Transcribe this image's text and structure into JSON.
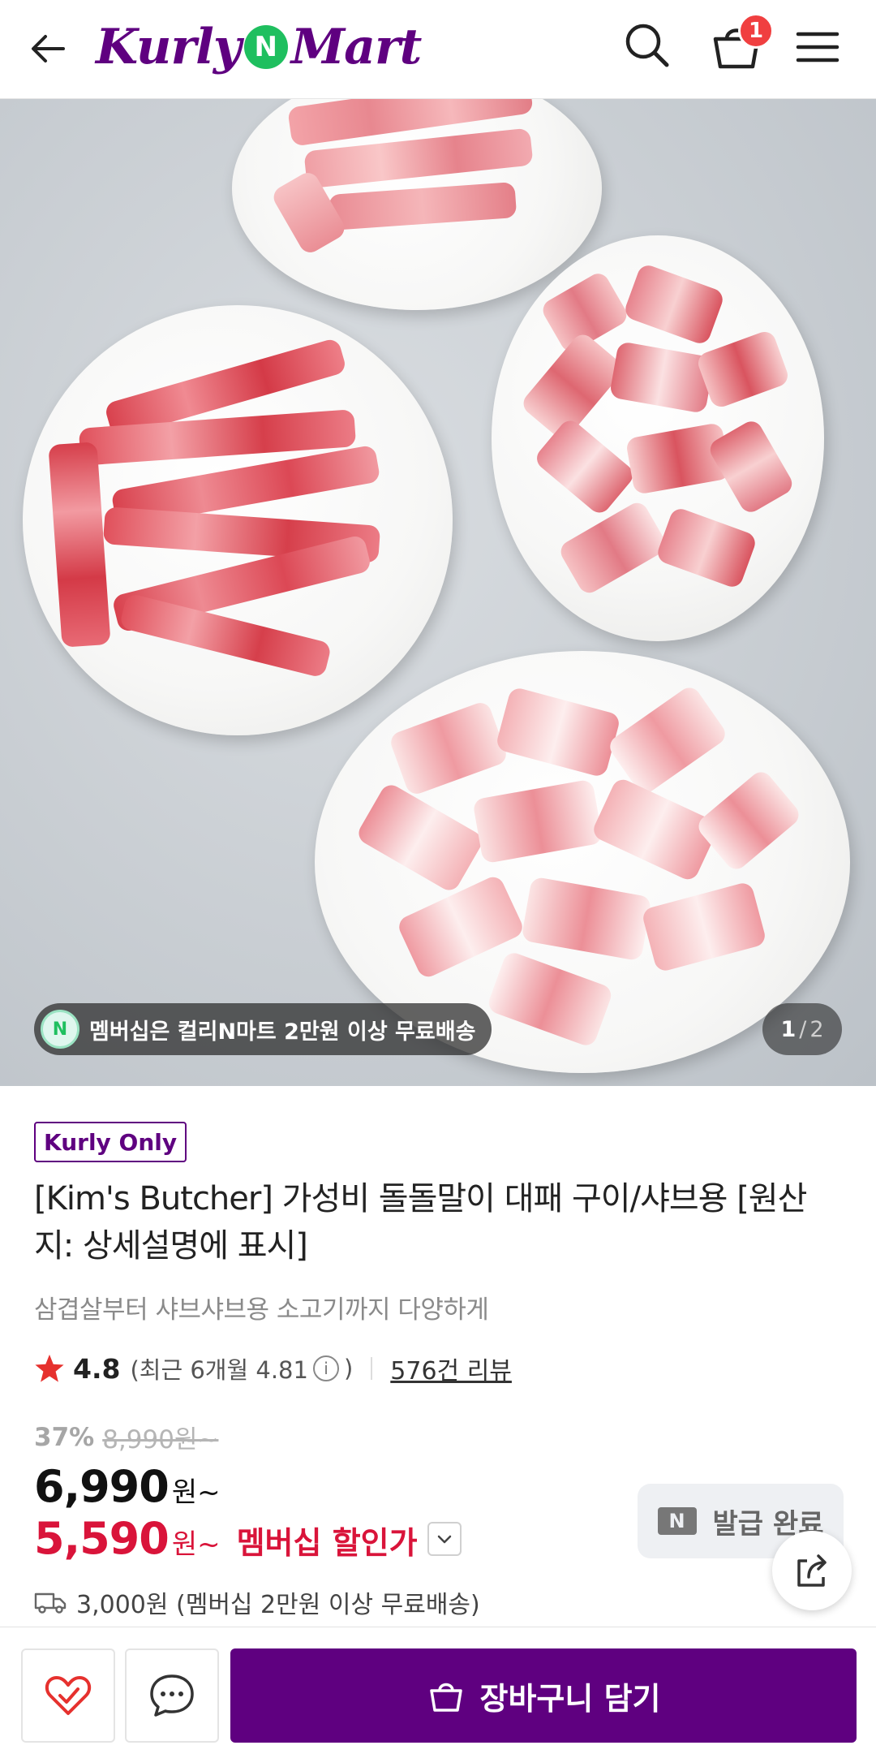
{
  "header": {
    "logo_part1": "Kurly",
    "logo_n": "N",
    "logo_part2": "Mart",
    "cart_count": "1"
  },
  "hero": {
    "membership_notice": "멤버십은 컬리N마트 2만원 이상 무료배송",
    "membership_n": "N",
    "page_current": "1",
    "page_separator": "/",
    "page_total": "2"
  },
  "product": {
    "badge": "Kurly Only",
    "title": "[Kim's Butcher] 가성비 돌돌말이 대패 구이/샤브용 [원산지: 상세설명에 표시]",
    "subtitle": "삼겹살부터 샤브샤브용 소고기까지 다양하게",
    "rating": "4.8",
    "recent_rating_text": "(최근 6개월 4.81",
    "recent_rating_close": ")",
    "review_count": "576건 리뷰",
    "discount_rate": "37%",
    "original_price": "8,990원~",
    "price": "6,990",
    "price_unit": "원~",
    "member_price": "5,590",
    "member_price_unit": "원~",
    "member_price_label": "멤버십 할인가",
    "coupon_mark": "N",
    "coupon_label": "발급 완료",
    "delivery": "3,000원 (멤버십 2만원 이상 무료배송)"
  },
  "bottom_bar": {
    "add_to_cart": "장바구니 담기"
  },
  "colors": {
    "brand_purple": "#5f0080",
    "member_red": "#d9143a",
    "badge_red": "#f03f40",
    "n_green": "#1fbf5f"
  }
}
